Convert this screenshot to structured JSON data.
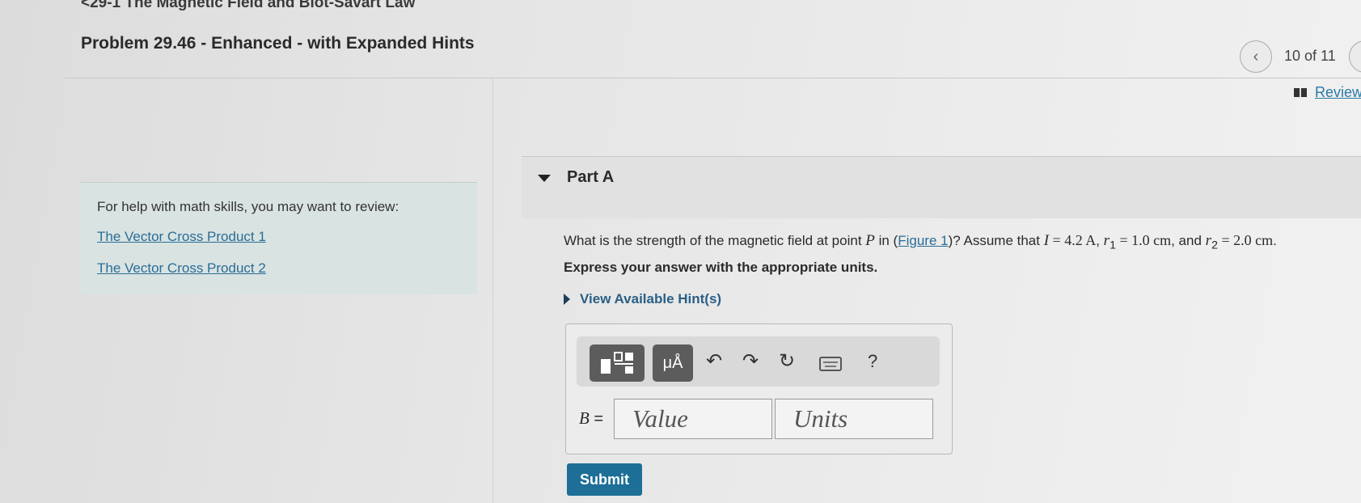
{
  "breadcrumb": "<29-1 The Magnetic Field and Biot-Savart Law",
  "title": "Problem 29.46 - Enhanced - with Expanded Hints",
  "nav": {
    "prev_icon": "chevron-left-icon",
    "counter": "10 of 11"
  },
  "review": {
    "icon": "book-icon",
    "label": "Review"
  },
  "help": {
    "text": "For help with math skills, you may want to review:",
    "links": [
      "The Vector Cross Product 1",
      "The Vector Cross Product 2"
    ]
  },
  "part": {
    "label": "Part A"
  },
  "question": {
    "pre": "What is the strength of the magnetic field at point ",
    "point": "P",
    "in_text": " in (",
    "figure_link": "Figure 1",
    "assume": ")? Assume that ",
    "I_sym": "I",
    "I_val": " = 4.2 A",
    "r1_sym": "r",
    "r1_sub": "1",
    "r1_val": " = 1.0 cm",
    "and_text": ", and ",
    "r2_sym": "r",
    "r2_sub": "2",
    "r2_val": " = 2.0 cm",
    "end": "."
  },
  "instruction": "Express your answer with the appropriate units.",
  "hints_label": "View Available Hint(s)",
  "toolbar": {
    "units_label": "μÅ",
    "help_label": "?",
    "icons": [
      "templates-icon",
      "units-icon",
      "undo-icon",
      "redo-icon",
      "reset-icon",
      "keyboard-icon",
      "help-icon"
    ]
  },
  "answer": {
    "variable": "B",
    "equals": " =",
    "value_placeholder": "Value",
    "units_placeholder": "Units"
  },
  "submit_label": "Submit"
}
